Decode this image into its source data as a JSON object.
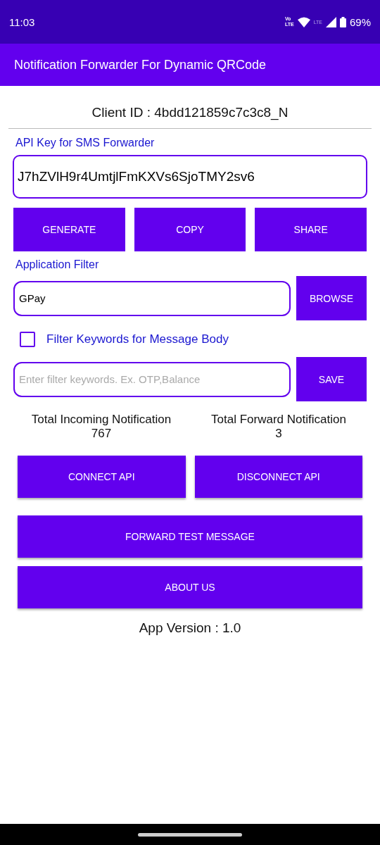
{
  "status_bar": {
    "time": "11:03",
    "volte_top": "Vo",
    "volte_bottom": "LTE",
    "lte": "LTE",
    "battery": "69%"
  },
  "app_bar": {
    "title": "Notification Forwarder For Dynamic QRCode"
  },
  "client_id": "Client ID : 4bdd121859c7c3c8_N",
  "api_key_label": "API Key for SMS Forwarder",
  "api_key_field": {
    "value": "J7hZVlH9r4UmtjlFmKXVs6SjoTMY2sv6"
  },
  "key_buttons": [
    "GENERATE",
    "COPY",
    "SHARE"
  ],
  "app_filter_label": "Application Filter",
  "app_filter_field": {
    "value": "GPay"
  },
  "browse_button": "BROWSE",
  "keyword_filter": {
    "label": "Filter Keywords for Message Body",
    "checked": false
  },
  "keyword_field": {
    "placeholder": "Enter filter keywords. Ex. OTP,Balance"
  },
  "save_button": "SAVE",
  "stats": [
    {
      "label": "Total Incoming Notification",
      "value": "767"
    },
    {
      "label": "Total Forward Notification",
      "value": "3"
    }
  ],
  "api_buttons": [
    "CONNECT API",
    "DISCONNECT API"
  ],
  "forward_test_button": "FORWARD TEST MESSAGE",
  "about_button": "ABOUT US",
  "app_version": "App Version : 1.0"
}
